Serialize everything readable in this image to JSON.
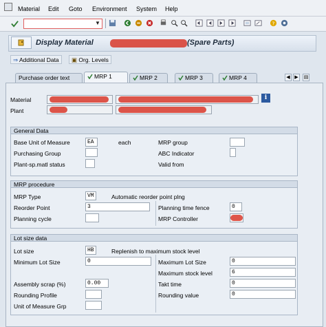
{
  "menu": [
    "Material",
    "Edit",
    "Goto",
    "Environment",
    "System",
    "Help"
  ],
  "title": {
    "prefix": "Display Material",
    "suffix": "(Spare Parts)"
  },
  "app_toolbar": {
    "additional_data": "Additional Data",
    "org_levels": "Org. Levels"
  },
  "tabs": [
    "Purchase order text",
    "MRP 1",
    "MRP 2",
    "MRP 3",
    "MRP 4"
  ],
  "header": {
    "material_label": "Material",
    "plant_label": "Plant"
  },
  "general": {
    "title": "General Data",
    "base_uom_label": "Base Unit of Measure",
    "base_uom_value": "EA",
    "base_uom_text": "each",
    "purchasing_group_label": "Purchasing Group",
    "purchasing_group_value": "",
    "plant_sp_status_label": "Plant-sp.matl status",
    "plant_sp_status_value": "",
    "mrp_group_label": "MRP group",
    "mrp_group_value": "",
    "abc_label": "ABC Indicator",
    "abc_value": "",
    "valid_from_label": "Valid from",
    "valid_from_value": ""
  },
  "mrp": {
    "title": "MRP procedure",
    "mrp_type_label": "MRP Type",
    "mrp_type_value": "VM",
    "mrp_type_text": "Automatic reorder point plng",
    "reorder_label": "Reorder Point",
    "reorder_value": "3",
    "planning_cycle_label": "Planning cycle",
    "planning_cycle_value": "",
    "fence_label": "Planning time fence",
    "fence_value": "0",
    "controller_label": "MRP Controller"
  },
  "lot": {
    "title": "Lot size data",
    "lot_size_label": "Lot size",
    "lot_size_value": "HB",
    "lot_size_text": "Replenish to maximum stock level",
    "min_lot_label": "Minimum Lot Size",
    "min_lot_value": "0",
    "max_lot_label": "Maximum Lot Size",
    "max_lot_value": "0",
    "max_stock_label": "Maximum stock level",
    "max_stock_value": "6",
    "assembly_scrap_label": "Assembly scrap (%)",
    "assembly_scrap_value": "0.00",
    "takt_label": "Takt time",
    "takt_value": "0",
    "rounding_profile_label": "Rounding Profile",
    "rounding_profile_value": "",
    "rounding_value_label": "Rounding value",
    "rounding_value_value": "0",
    "uom_grp_label": "Unit of Measure Grp",
    "uom_grp_value": ""
  }
}
